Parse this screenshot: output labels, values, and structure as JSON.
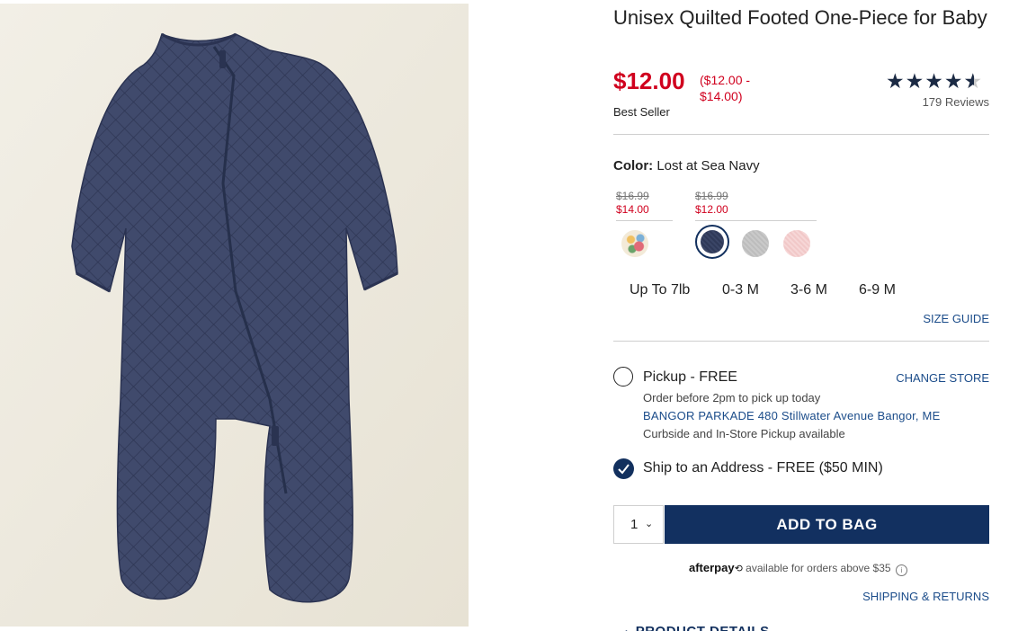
{
  "product": {
    "title": "Unisex Quilted Footed One-Piece for Baby",
    "sale_price": "$12.00",
    "price_range": "($12.00 - $14.00)",
    "badge": "Best Seller",
    "rating_stars": 4.5,
    "reviews": "179 Reviews",
    "image_icon": "navy-quilted-footed-one-piece"
  },
  "color": {
    "label": "Color:",
    "value": "Lost at Sea Navy",
    "price_groups": [
      {
        "old": "$16.99",
        "new": "$14.00"
      },
      {
        "old": "$16.99",
        "new": "$12.00"
      }
    ],
    "swatches": [
      {
        "name": "floral",
        "selected": false
      },
      {
        "name": "navy",
        "selected": true
      },
      {
        "name": "heather-gray",
        "selected": false
      },
      {
        "name": "pink",
        "selected": false
      }
    ]
  },
  "sizes": [
    "Up To 7lb",
    "0-3 M",
    "3-6 M",
    "6-9 M"
  ],
  "size_guide": "SIZE GUIDE",
  "fulfillment": {
    "pickup": {
      "label": "Pickup - FREE",
      "selected": false,
      "change_store": "CHANGE STORE",
      "note": "Order before 2pm to pick up today",
      "address": "BANGOR PARKADE 480 Stillwater Avenue  Bangor, ME",
      "curbside": "Curbside and In-Store Pickup available"
    },
    "ship": {
      "label": "Ship to an Address - FREE ($50 MIN)",
      "selected": true
    }
  },
  "cart": {
    "quantity": "1",
    "add_label": "ADD TO BAG"
  },
  "afterpay": {
    "logo": "afterpay",
    "text": "available for orders above $35",
    "info": "i"
  },
  "shipping_returns": "SHIPPING & RETURNS",
  "product_details": "PRODUCT DETAILS",
  "colors": {
    "accent_red": "#d0001e",
    "brand_navy": "#123060",
    "link_blue": "#1b4c8a"
  }
}
